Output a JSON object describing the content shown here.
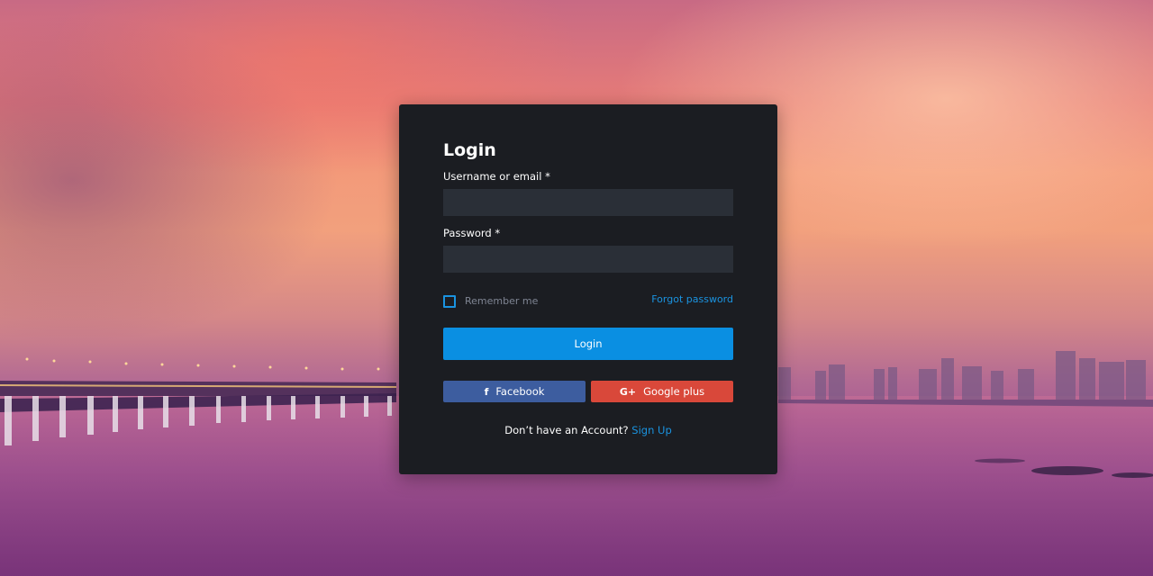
{
  "login": {
    "title": "Login",
    "username_label": "Username or email *",
    "username_value": "",
    "password_label": "Password *",
    "password_value": "",
    "remember_label": "Remember me",
    "remember_checked": false,
    "forgot_label": "Forgot password",
    "login_button": "Login",
    "facebook_label": "Facebook",
    "facebook_icon": "facebook-icon",
    "google_label": "Google plus",
    "google_icon": "google-plus-icon",
    "no_account_text": "Don’t have an Account?",
    "signup_label": "Sign Up"
  },
  "colors": {
    "accent": "#0a8fe2",
    "card": "#1b1d22",
    "input": "#2a2f37",
    "facebook": "#3d5d9f",
    "google": "#d9483a"
  }
}
